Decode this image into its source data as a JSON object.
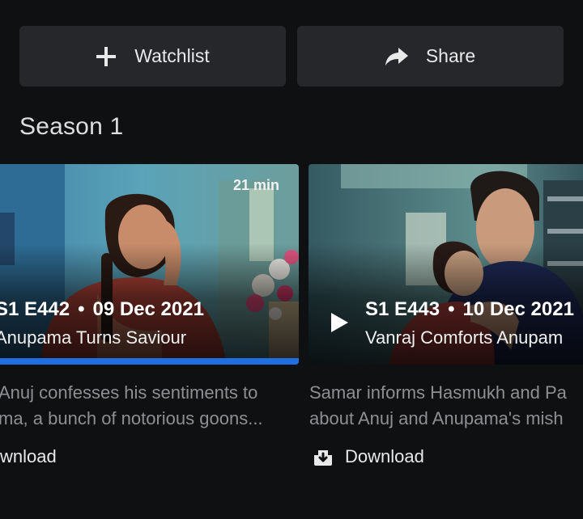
{
  "actions": {
    "watchlist_label": "Watchlist",
    "share_label": "Share"
  },
  "season": {
    "title": "Season 1"
  },
  "episodes": [
    {
      "code": "S1 E442",
      "date": "09 Dec 2021",
      "title": "Anupama Turns Saviour",
      "duration": "21 min",
      "description_line1": "Anuj confesses his sentiments to",
      "description_line2": "ma, a bunch of notorious goons...",
      "download_label": "wnload",
      "watch_progress": 1.0
    },
    {
      "code": "S1 E443",
      "date": "10 Dec 2021",
      "title": "Vanraj Comforts Anupam",
      "description_line1": "Samar informs Hasmukh and Pa",
      "description_line2": "about Anuj and Anupama's mish",
      "download_label": "Download"
    }
  ],
  "separator": "•",
  "colors": {
    "background": "#0f1012",
    "button_bg": "#25272b",
    "progress": "#1f6fe0",
    "muted_text": "#8d8f92"
  },
  "icons": {
    "watchlist": "plus-icon",
    "share": "share-arrow-icon",
    "play": "play-icon",
    "download": "download-icon"
  }
}
